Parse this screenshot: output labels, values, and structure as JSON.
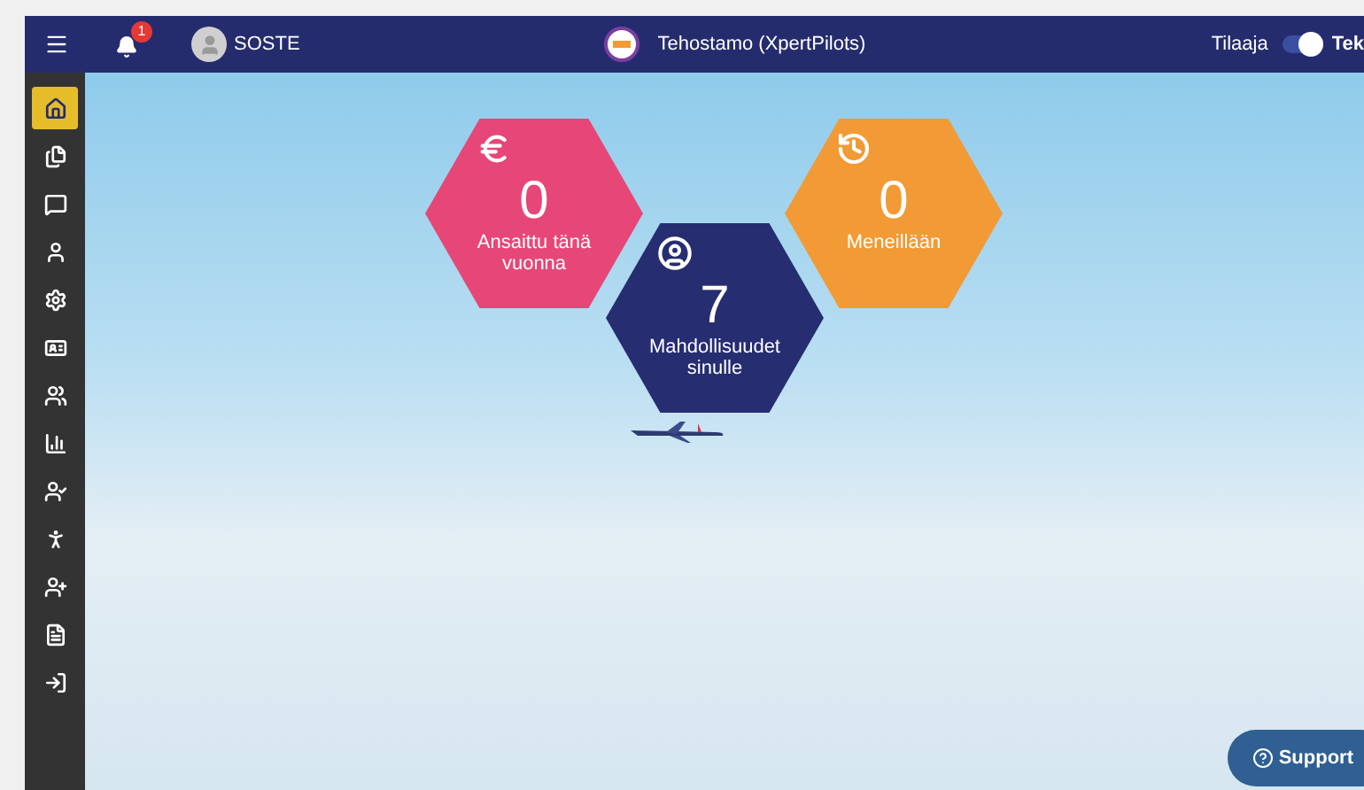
{
  "header": {
    "notifications": {
      "count": "1"
    },
    "user": {
      "name": "SOSTE"
    },
    "title": "Tehostamo (XpertPilots)",
    "role_toggle": {
      "left_label": "Tilaaja",
      "on": true,
      "right_label": "Tek"
    }
  },
  "sidebar": {
    "items": [
      {
        "kind": "home",
        "selected": true
      },
      {
        "kind": "documents",
        "selected": false
      },
      {
        "kind": "chat",
        "selected": false
      },
      {
        "kind": "person",
        "selected": false
      },
      {
        "kind": "settings",
        "selected": false
      },
      {
        "kind": "card",
        "selected": false
      },
      {
        "kind": "people",
        "selected": false
      },
      {
        "kind": "chart",
        "selected": false
      },
      {
        "kind": "person-check",
        "selected": false
      },
      {
        "kind": "walker",
        "selected": false
      },
      {
        "kind": "person-add",
        "selected": false
      },
      {
        "kind": "file",
        "selected": false
      },
      {
        "kind": "login",
        "selected": false
      }
    ]
  },
  "tiles": [
    {
      "kind": "euro",
      "value": "0",
      "label": "Ansaittu tänä vuonna",
      "color": "#e64776"
    },
    {
      "kind": "person",
      "value": "7",
      "label": "Mahdollisuudet sinulle",
      "color": "#262d70"
    },
    {
      "kind": "history",
      "value": "0",
      "label": "Meneillään",
      "color": "#f29a36"
    }
  ],
  "support_button": {
    "label": "Support"
  }
}
